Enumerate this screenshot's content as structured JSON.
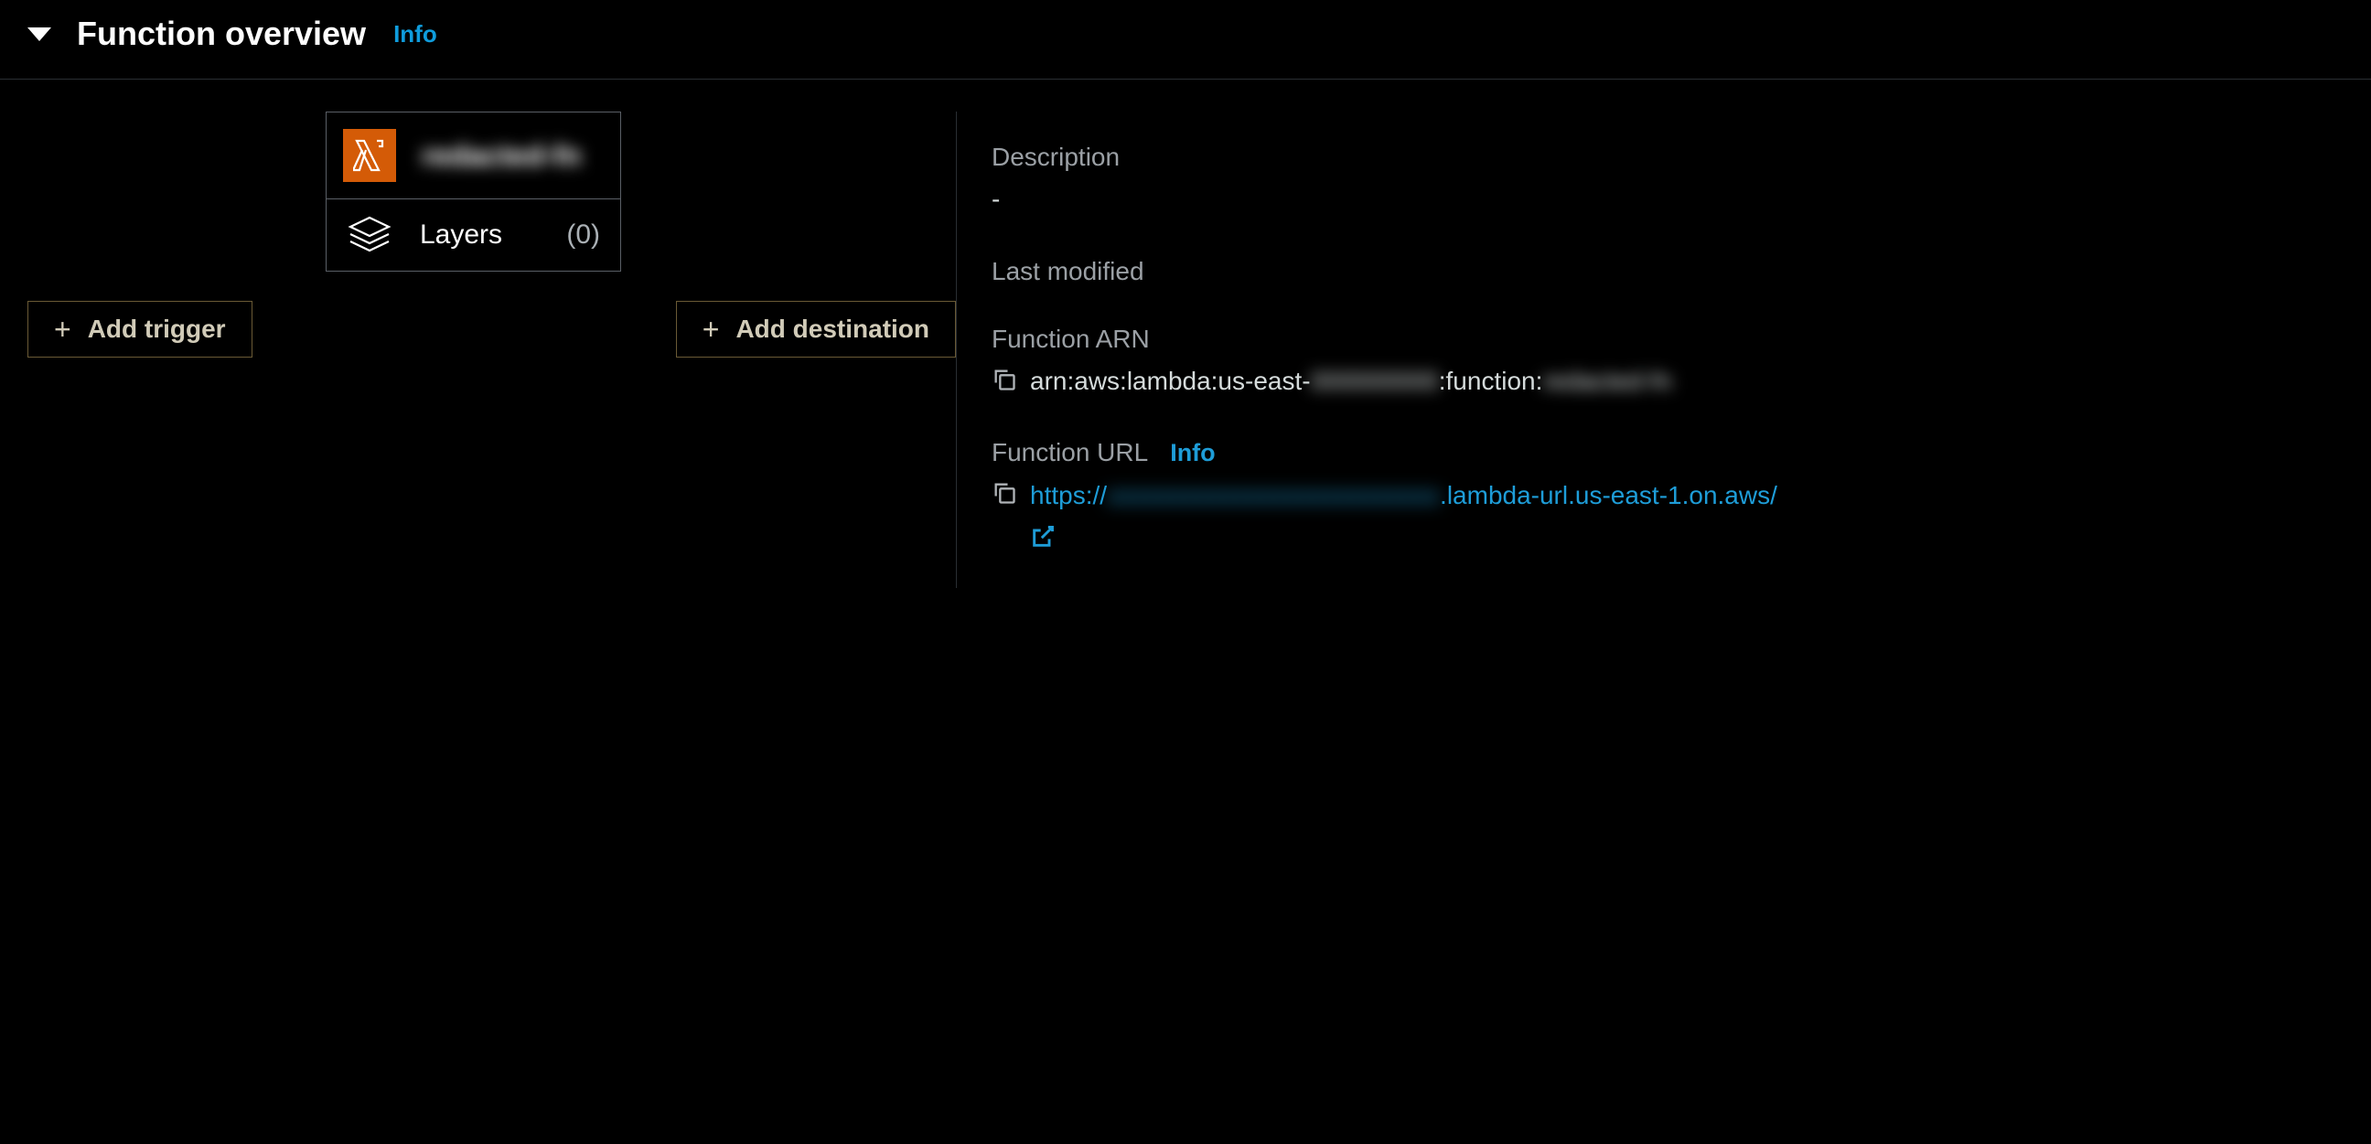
{
  "header": {
    "title": "Function overview",
    "info_label": "Info"
  },
  "function": {
    "name": "redacted-fn",
    "layers": {
      "label": "Layers",
      "count": "(0)"
    }
  },
  "buttons": {
    "add_trigger": "Add trigger",
    "add_destination": "Add destination"
  },
  "details": {
    "description": {
      "label": "Description",
      "value": "-"
    },
    "last_modified": {
      "label": "Last modified",
      "value": ""
    },
    "function_arn": {
      "label": "Function ARN",
      "prefix": "arn:aws:lambda:us-east-",
      "redacted1": "000000000",
      "mid": ":function:",
      "redacted2": "redacted-fn"
    },
    "function_url": {
      "label": "Function URL",
      "info_label": "Info",
      "prefix": "https://",
      "redacted1": "xxxxxxxxxxxxxxxxxxxxxxxxxx",
      "suffix": ".lambda-url.us-east-1.on.aws/"
    }
  }
}
